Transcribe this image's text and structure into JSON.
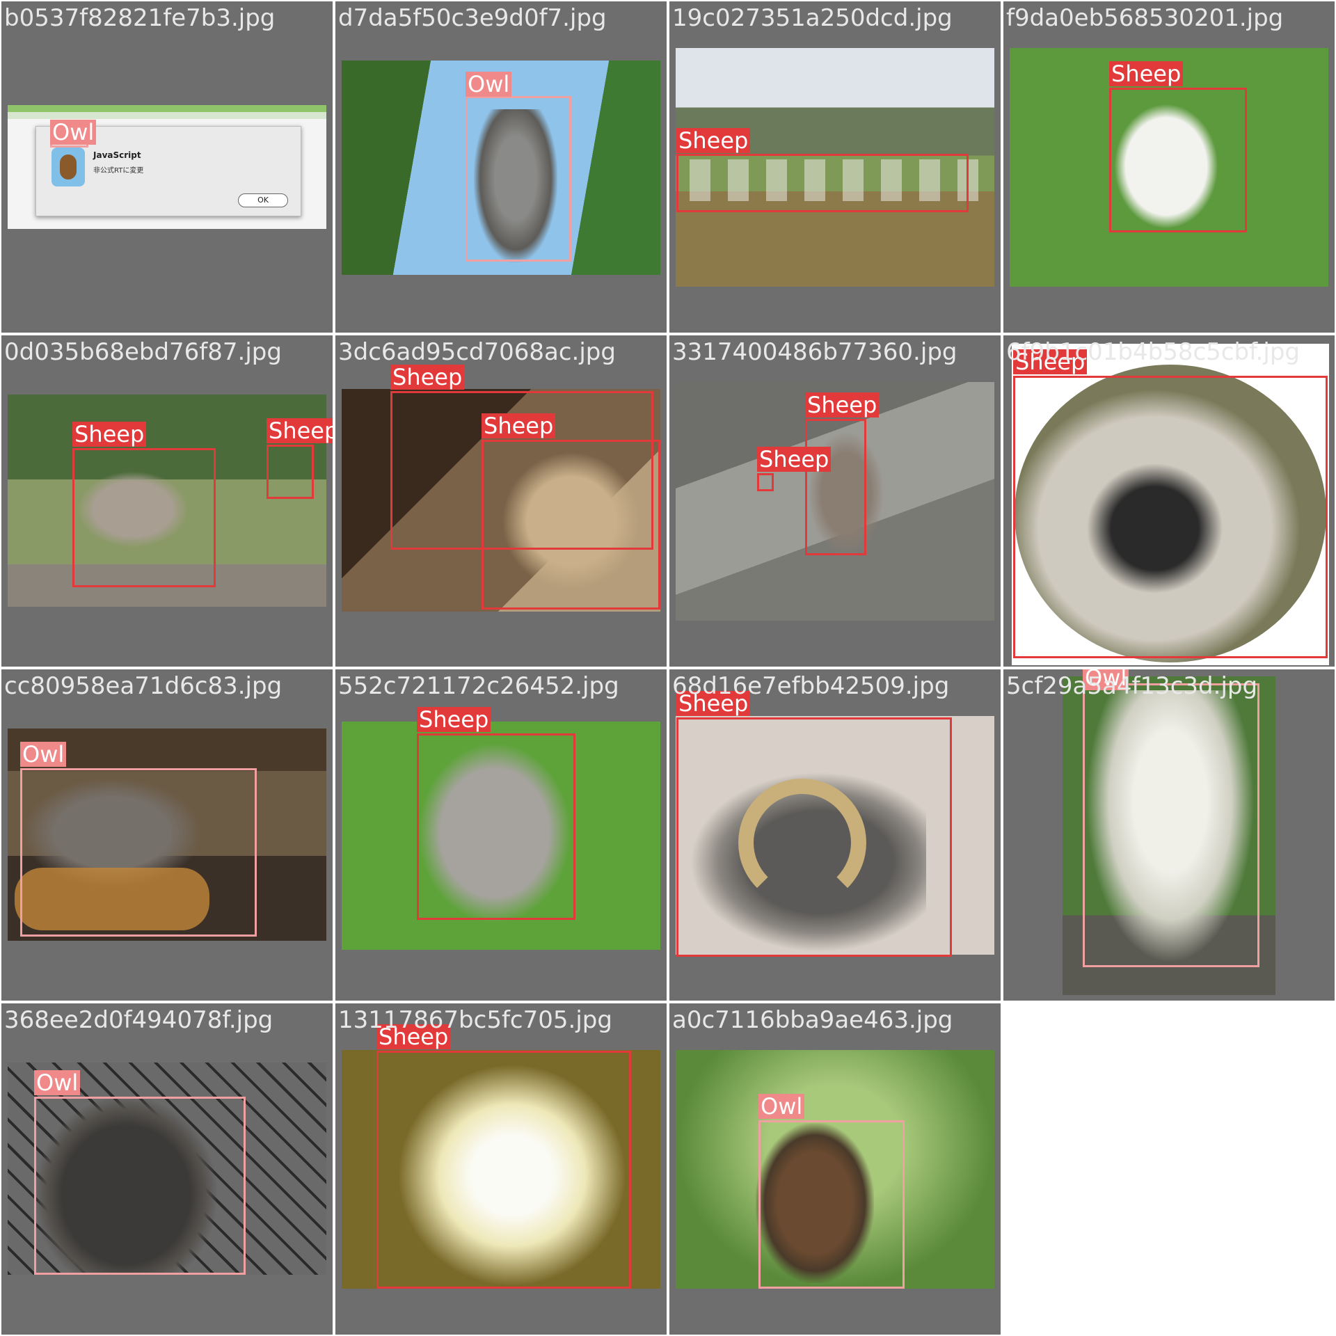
{
  "colors": {
    "background": "#6e6e6e",
    "sheep_box": "#e23a3a",
    "owl_box": "#f0a0a0",
    "filename_text": "#e8e8e8"
  },
  "tiles": [
    {
      "filename": "b0537f82821fe7b3.jpg",
      "photo_kind": "screenshot",
      "dialog": {
        "title": "JavaScript",
        "message": "非公式RTに変更",
        "button": "OK"
      },
      "boxes": [
        {
          "label": "Owl"
        }
      ]
    },
    {
      "filename": "d7da5f50c3e9d0f7.jpg",
      "photo_kind": "owl-in-trees",
      "boxes": [
        {
          "label": "Owl"
        }
      ]
    },
    {
      "filename": "19c027351a250dcd.jpg",
      "photo_kind": "sheep-valley",
      "boxes": [
        {
          "label": "Sheep"
        }
      ]
    },
    {
      "filename": "f9da0eb568530201.jpg",
      "photo_kind": "lamb-grass",
      "boxes": [
        {
          "label": "Sheep"
        }
      ]
    },
    {
      "filename": "0d035b68ebd76f87.jpg",
      "photo_kind": "bighorn-meadow",
      "boxes": [
        {
          "label": "Sheep"
        },
        {
          "label": "Sheep"
        }
      ]
    },
    {
      "filename": "3dc6ad95cd7068ac.jpg",
      "photo_kind": "bighorn-rocks",
      "boxes": [
        {
          "label": "Sheep"
        },
        {
          "label": "Sheep"
        }
      ]
    },
    {
      "filename": "3317400486b77360.jpg",
      "photo_kind": "bighorn-cliff",
      "boxes": [
        {
          "label": "Sheep"
        },
        {
          "label": "Sheep"
        }
      ]
    },
    {
      "filename": "6f9b1c01b4b58c5cbf.jpg",
      "photo_kind": "swaledale-fisheye",
      "boxes": [
        {
          "label": "Sheep"
        }
      ]
    },
    {
      "filename": "cc80958ea71d6c83.jpg",
      "photo_kind": "owl-on-rock",
      "boxes": [
        {
          "label": "Owl"
        }
      ]
    },
    {
      "filename": "552c721172c26452.jpg",
      "photo_kind": "alpaca-grass",
      "boxes": [
        {
          "label": "Sheep"
        }
      ]
    },
    {
      "filename": "68d16e7efbb42509.jpg",
      "photo_kind": "ram-closeup",
      "boxes": [
        {
          "label": "Sheep"
        }
      ]
    },
    {
      "filename": "5cf29a5a4f13c3d.jpg",
      "photo_kind": "snowy-owl",
      "boxes": [
        {
          "label": "Owl"
        }
      ]
    },
    {
      "filename": "368ee2d0f494078f.jpg",
      "photo_kind": "great-grey-owl",
      "boxes": [
        {
          "label": "Owl"
        }
      ]
    },
    {
      "filename": "13117867bc5fc705.jpg",
      "photo_kind": "white-sheep-face",
      "boxes": [
        {
          "label": "Sheep"
        }
      ]
    },
    {
      "filename": "a0c7116bba9ae463.jpg",
      "photo_kind": "boobook-owl",
      "boxes": [
        {
          "label": "Owl"
        }
      ]
    }
  ]
}
